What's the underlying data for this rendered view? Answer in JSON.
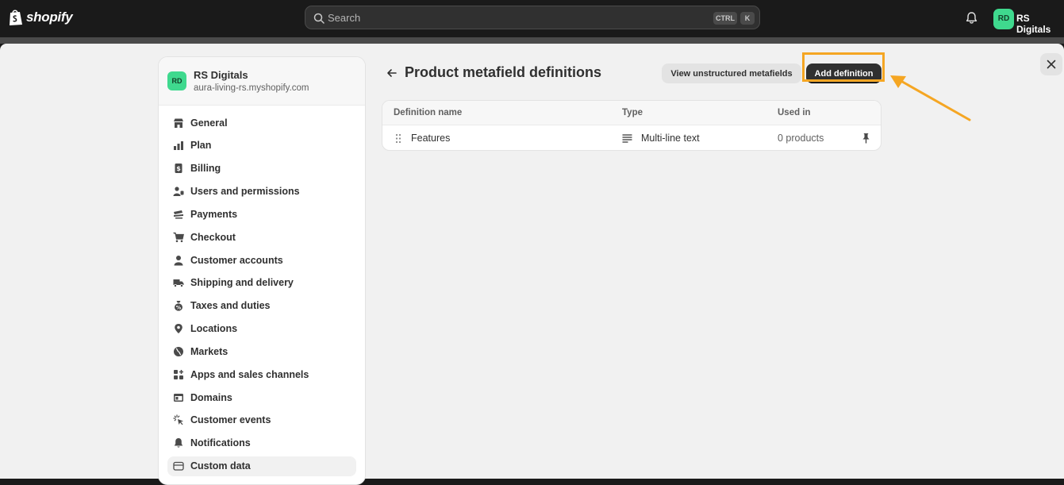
{
  "topbar": {
    "logo_text": "shopify",
    "search_placeholder": "Search",
    "shortcut_ctrl": "CTRL",
    "shortcut_k": "K",
    "avatar_initials": "RD",
    "store_name": "RS Digitals"
  },
  "sidebar": {
    "store": {
      "initials": "RD",
      "name": "RS Digitals",
      "domain": "aura-living-rs.myshopify.com"
    },
    "items": [
      {
        "label": "General",
        "icon": "store-icon"
      },
      {
        "label": "Plan",
        "icon": "plan-icon"
      },
      {
        "label": "Billing",
        "icon": "billing-icon"
      },
      {
        "label": "Users and permissions",
        "icon": "users-icon"
      },
      {
        "label": "Payments",
        "icon": "payments-icon"
      },
      {
        "label": "Checkout",
        "icon": "cart-icon"
      },
      {
        "label": "Customer accounts",
        "icon": "person-icon"
      },
      {
        "label": "Shipping and delivery",
        "icon": "truck-icon"
      },
      {
        "label": "Taxes and duties",
        "icon": "tax-bag-icon"
      },
      {
        "label": "Locations",
        "icon": "location-pin-icon"
      },
      {
        "label": "Markets",
        "icon": "globe-icon"
      },
      {
        "label": "Apps and sales channels",
        "icon": "apps-icon"
      },
      {
        "label": "Domains",
        "icon": "domain-icon"
      },
      {
        "label": "Customer events",
        "icon": "cursor-icon"
      },
      {
        "label": "Notifications",
        "icon": "bell-icon"
      },
      {
        "label": "Custom data",
        "icon": "custom-data-icon",
        "active": true
      }
    ]
  },
  "main": {
    "title": "Product metafield definitions",
    "view_unstructured_label": "View unstructured metafields",
    "add_definition_label": "Add definition",
    "table": {
      "headers": [
        "Definition name",
        "Type",
        "Used in"
      ],
      "rows": [
        {
          "name": "Features",
          "type": "Multi-line text",
          "used_in": "0 products"
        }
      ]
    }
  },
  "colors": {
    "accent_highlight": "#f5a623",
    "avatar_green": "#3fd98e",
    "primary_button": "#303030"
  }
}
